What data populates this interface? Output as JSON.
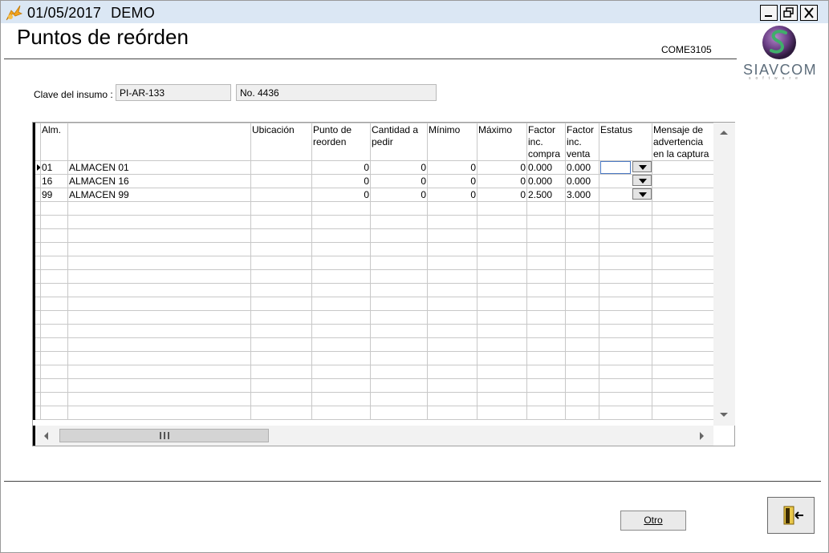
{
  "window": {
    "date": "01/05/2017",
    "mode": "DEMO",
    "minimize_icon": "minimize-icon",
    "restore_icon": "restore-icon",
    "close_icon": "close-icon"
  },
  "header": {
    "title": "Puntos de reórden",
    "screen_code": "COME3105",
    "logo_text": "SIAVCOM",
    "logo_subtext": "software"
  },
  "insumo": {
    "label": "Clave del insumo :",
    "clave": "PI-AR-133",
    "numero": "No. 4436"
  },
  "grid": {
    "columns": [
      "Alm.",
      "",
      "Ubicación",
      "Punto de reorden",
      "Cantidad a pedir",
      "Mínimo",
      "Máximo",
      "Factor inc. compra",
      "Factor inc. venta",
      "Estatus",
      "Mensaje de advertencia en la captura"
    ],
    "rows": [
      {
        "alm": "01",
        "nombre": "ALMACEN 01",
        "ubicacion": "",
        "punto": "0",
        "cantidad": "0",
        "minimo": "0",
        "maximo": "0",
        "fcompra": "0.000",
        "fventa": "0.000",
        "estatus": "",
        "mensaje": ""
      },
      {
        "alm": "16",
        "nombre": "ALMACEN 16",
        "ubicacion": "",
        "punto": "0",
        "cantidad": "0",
        "minimo": "0",
        "maximo": "0",
        "fcompra": "0.000",
        "fventa": "0.000",
        "estatus": "",
        "mensaje": ""
      },
      {
        "alm": "99",
        "nombre": "ALMACEN 99",
        "ubicacion": "",
        "punto": "0",
        "cantidad": "0",
        "minimo": "0",
        "maximo": "0",
        "fcompra": "2.500",
        "fventa": "3.000",
        "estatus": "",
        "mensaje": ""
      }
    ],
    "selected_row": 0
  },
  "buttons": {
    "otro": "Otro",
    "exit_icon": "exit-door-icon"
  },
  "colors": {
    "titlebar": "#dbe7f4",
    "selection": "#4a78c2"
  }
}
